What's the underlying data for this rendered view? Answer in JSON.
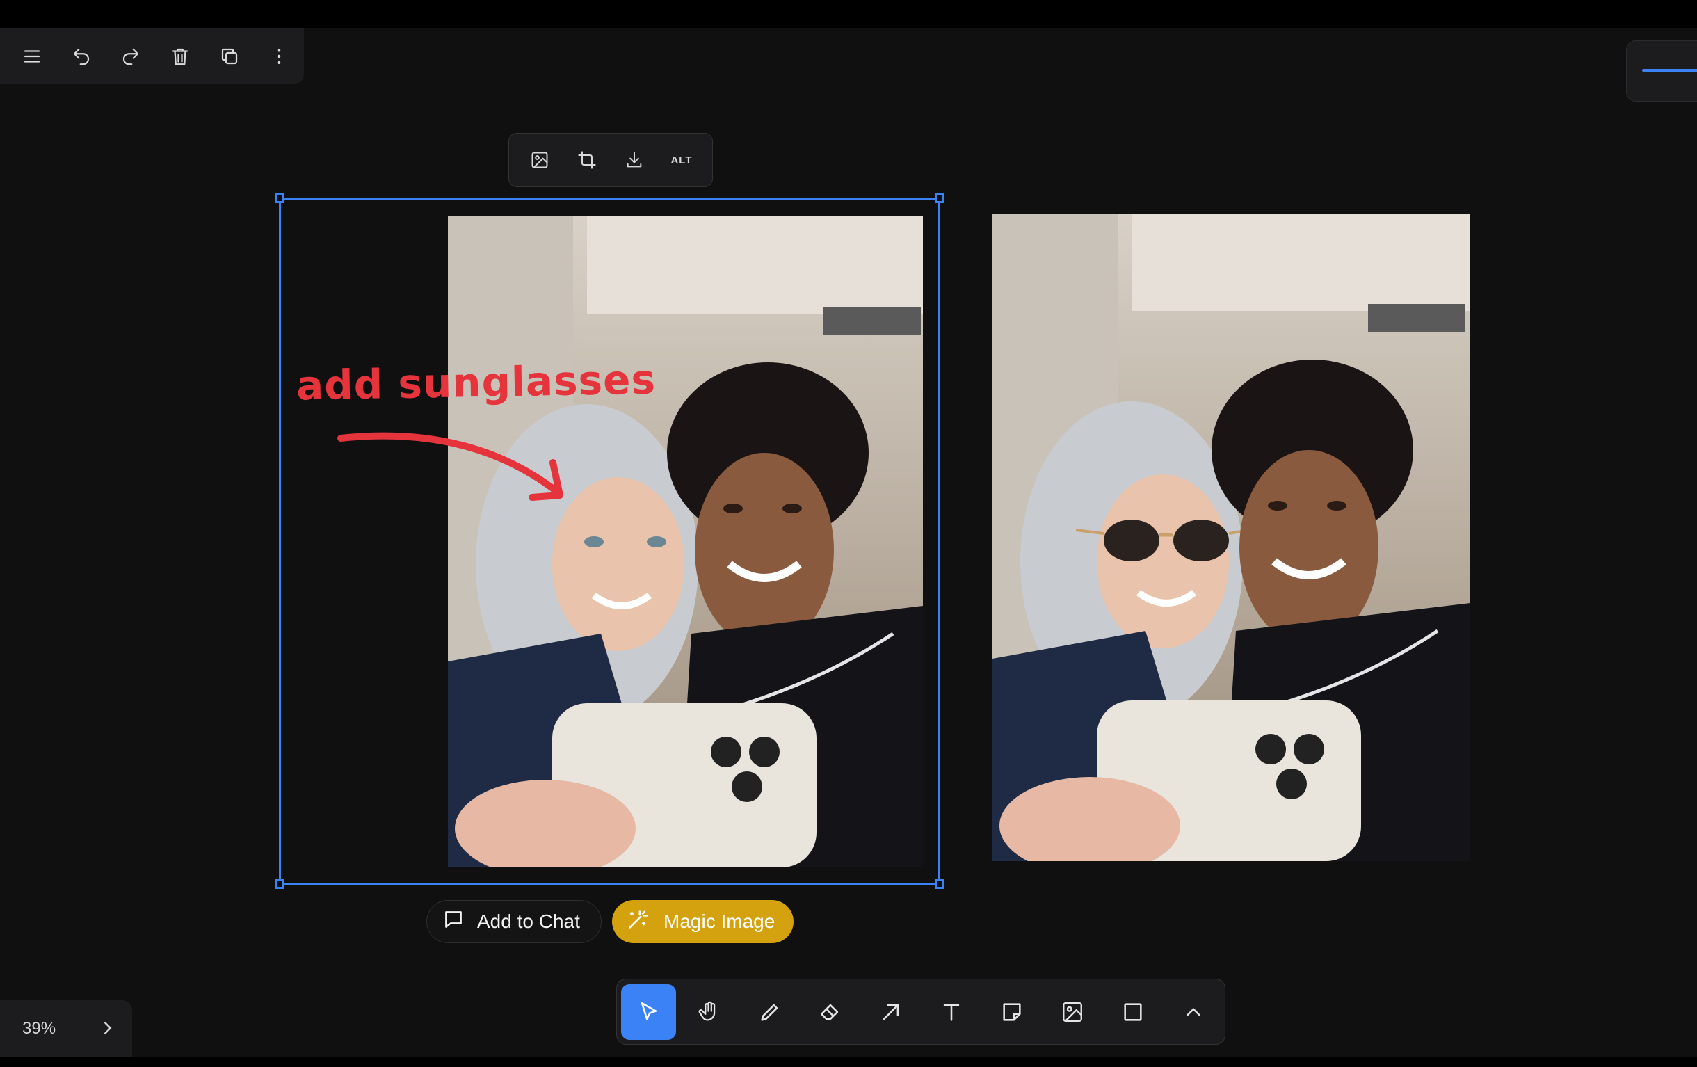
{
  "top_toolbar": {
    "buttons": [
      "menu-icon",
      "undo-icon",
      "redo-icon",
      "trash-icon",
      "duplicate-icon",
      "more-vertical-icon"
    ]
  },
  "image_toolbar": {
    "buttons": [
      "replace-image-icon",
      "crop-icon",
      "download-icon"
    ],
    "alt_label": "ALT"
  },
  "annotation": {
    "text": "add sunglasses",
    "color": "#e5343c"
  },
  "actions": {
    "add_to_chat": "Add to Chat",
    "magic_image": "Magic Image",
    "magic_color": "#d4a20f"
  },
  "tools": {
    "items": [
      "pointer-icon",
      "hand-icon",
      "pencil-icon",
      "eraser-icon",
      "arrow-icon",
      "text-icon",
      "sticky-note-icon",
      "image-icon",
      "rectangle-icon",
      "chevron-up-icon"
    ],
    "active": "pointer-icon"
  },
  "zoom": {
    "level": "39%"
  },
  "accent": "#3b82f6"
}
